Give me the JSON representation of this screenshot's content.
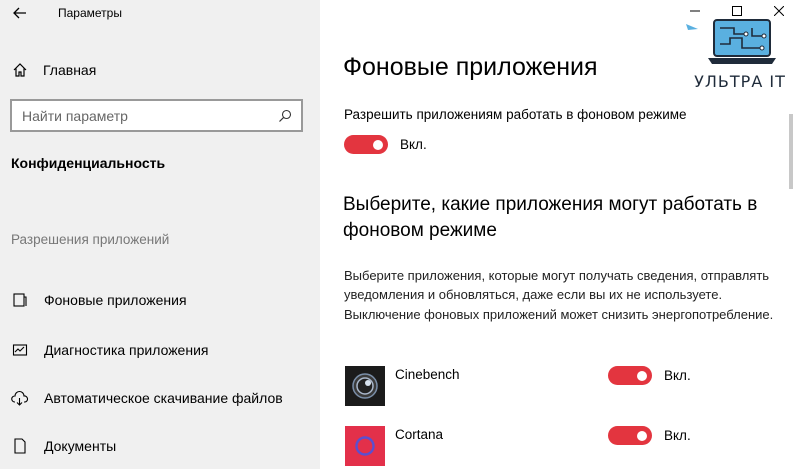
{
  "window": {
    "title": "Параметры"
  },
  "sidebar": {
    "home_label": "Главная",
    "search_placeholder": "Найти параметр",
    "section_heading": "Конфиденциальность",
    "group_heading": "Разрешения приложений",
    "items": [
      {
        "label": "Фоновые приложения",
        "icon": "background-apps-icon"
      },
      {
        "label": "Диагностика приложения",
        "icon": "app-diagnostics-icon"
      },
      {
        "label": "Автоматическое скачивание файлов",
        "icon": "cloud-download-icon"
      },
      {
        "label": "Документы",
        "icon": "document-icon"
      }
    ]
  },
  "logo": {
    "text": "УЛЬТРА IT"
  },
  "main": {
    "page_title": "Фоновые приложения",
    "allow_label": "Разрешить приложениям работать в фоновом режиме",
    "allow_state": "Вкл.",
    "choose_heading": "Выберите, какие приложения могут работать в фоновом режиме",
    "description": "Выберите приложения, которые могут получать сведения, отправлять уведомления и обновляться, даже если вы их не используете. Выключение фоновых приложений может снизить энергопотребление.",
    "apps": [
      {
        "name": "Cinebench",
        "state": "Вкл.",
        "icon": "cinebench-icon"
      },
      {
        "name": "Cortana",
        "state": "Вкл.",
        "icon": "cortana-icon"
      }
    ]
  },
  "colors": {
    "accent_toggle": "#e3353f",
    "sidebar_bg": "#f0f0f0",
    "cortana_bg": "#e3304a",
    "logo_blue": "#5ab0e0"
  }
}
